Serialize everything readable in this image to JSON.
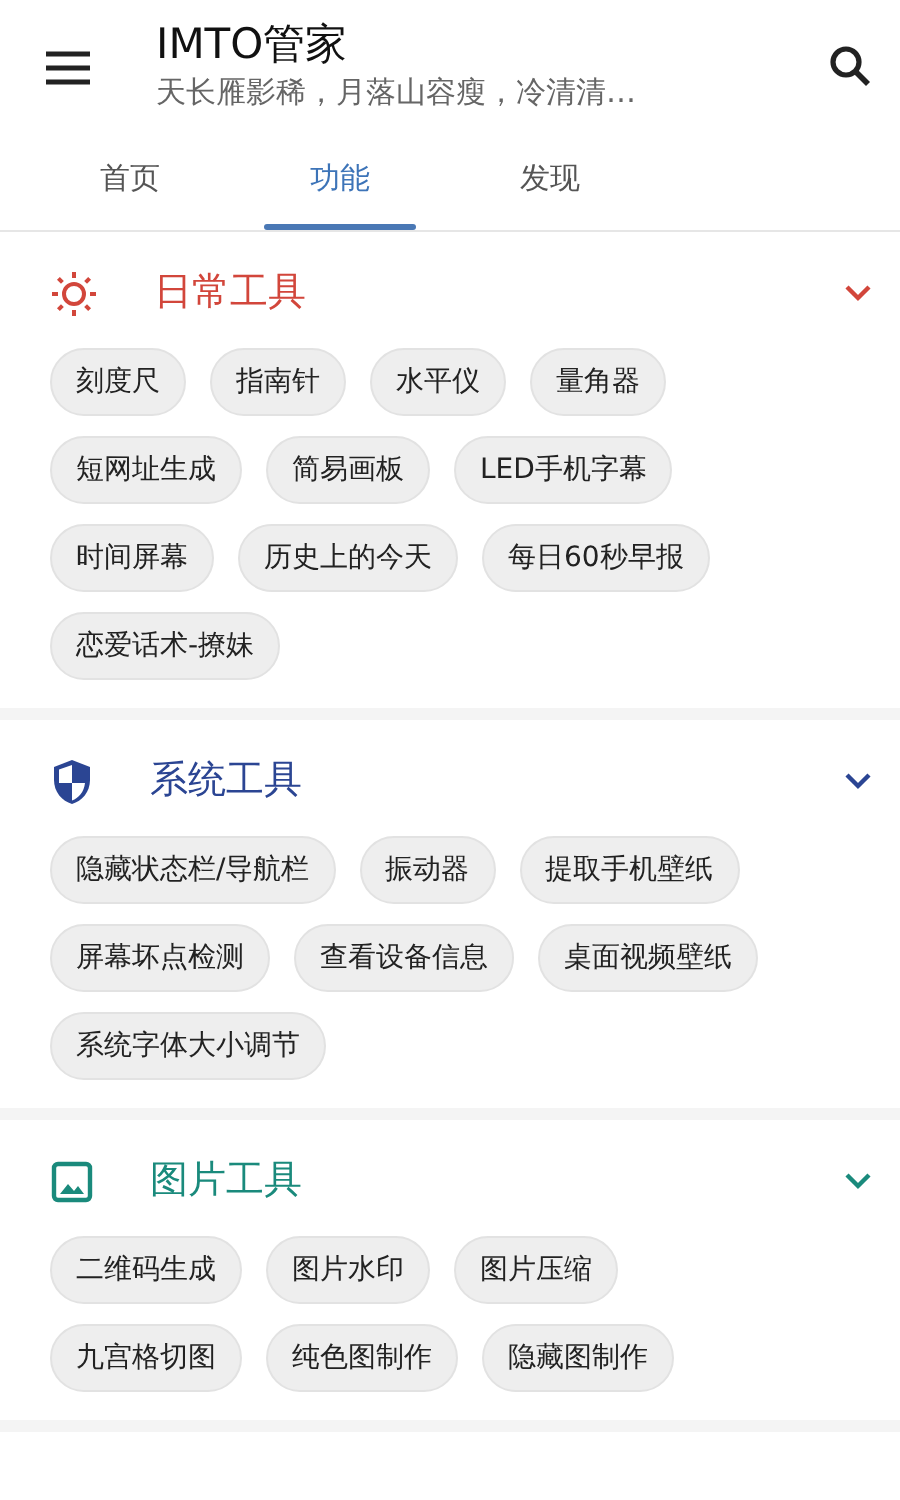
{
  "app_bar": {
    "title": "IMTO管家",
    "subtitle": "天长雁影稀，月落山容瘦，冷清清…"
  },
  "tabs": [
    {
      "label": "首页",
      "selected": false
    },
    {
      "label": "功能",
      "selected": true
    },
    {
      "label": "发现",
      "selected": false
    }
  ],
  "sections": [
    {
      "title": "日常工具",
      "kind": "sun",
      "color": "#d2463b",
      "expanded": true,
      "items": [
        "刻度尺",
        "指南针",
        "水平仪",
        "量角器",
        "短网址生成",
        "简易画板",
        "LED手机字幕",
        "时间屏幕",
        "历史上的今天",
        "每日60秒早报",
        "恋爱话术-撩妹"
      ]
    },
    {
      "title": "系统工具",
      "kind": "shield",
      "color": "#2b4593",
      "expanded": true,
      "items": [
        "隐藏状态栏/导航栏",
        "振动器",
        "提取手机壁纸",
        "屏幕坏点检测",
        "查看设备信息",
        "桌面视频壁纸",
        "系统字体大小调节"
      ]
    },
    {
      "title": "图片工具",
      "kind": "image",
      "color": "#1a8a7c",
      "expanded": true,
      "items": [
        "二维码生成",
        "图片水印",
        "图片压缩",
        "九宫格切图",
        "纯色图制作",
        "隐藏图制作"
      ]
    }
  ]
}
